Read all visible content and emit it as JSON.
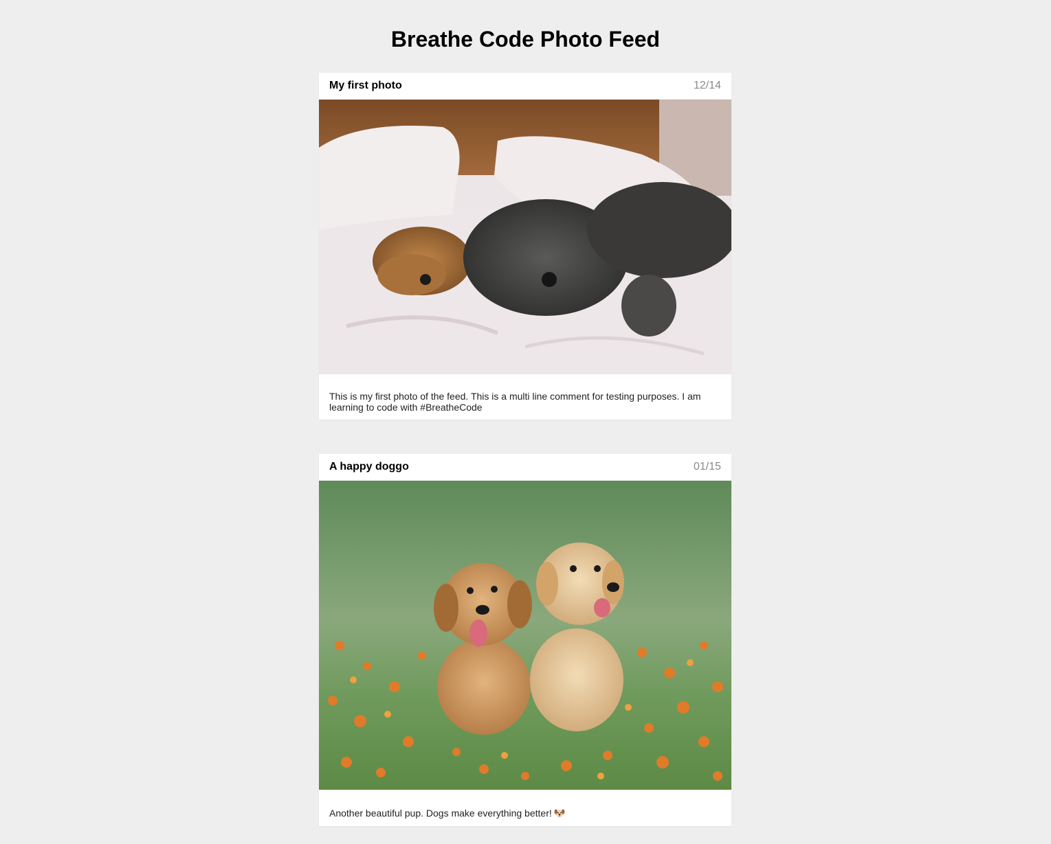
{
  "page": {
    "title": "Breathe Code Photo Feed"
  },
  "posts": [
    {
      "title": "My first photo",
      "date": "12/14",
      "photo_description": "two dogs sleeping on a bed",
      "caption": "This is my first photo of the feed. This is a multi line comment for testing purposes. I am learning to code with #BreatheCode"
    },
    {
      "title": "A happy doggo",
      "date": "01/15",
      "photo_description": "two golden retriever puppies in grass with orange flowers",
      "caption": "Another beautiful pup. Dogs make everything better!",
      "emoji": "dog-face-icon"
    }
  ],
  "colors": {
    "background": "#eeeeee",
    "card": "#ffffff",
    "date_text": "#8a8a8a"
  }
}
